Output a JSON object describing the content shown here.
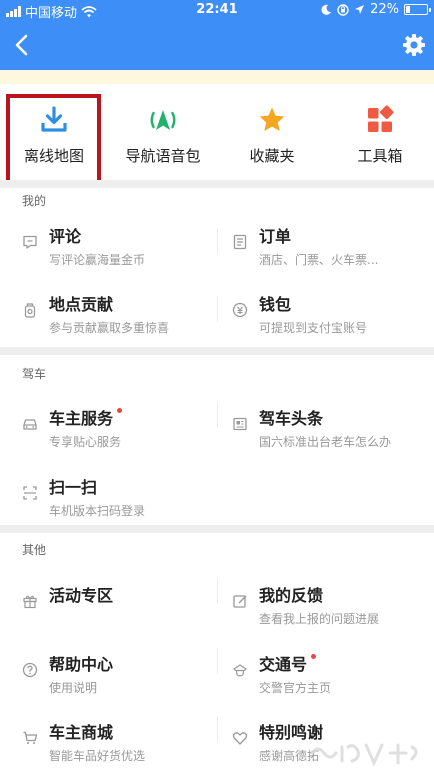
{
  "status_bar": {
    "carrier": "中国移动",
    "time": "22:41",
    "battery": "22%",
    "battery_level": 0.22
  },
  "quick_entries": [
    {
      "label": "离线地图",
      "icon": "download-icon",
      "color": "#2e8fe0"
    },
    {
      "label": "导航语音包",
      "icon": "navigation-voice-icon",
      "color": "#21b26f"
    },
    {
      "label": "收藏夹",
      "icon": "star-icon",
      "color": "#f5a623"
    },
    {
      "label": "工具箱",
      "icon": "toolbox-icon",
      "color": "#ef5a42"
    }
  ],
  "sections": [
    {
      "title": "我的",
      "items": [
        {
          "title": "评论",
          "subtitle": "写评论赢海量金币",
          "icon": "comment-icon",
          "dot": false
        },
        {
          "title": "订单",
          "subtitle": "酒店、门票、火车票...",
          "icon": "order-icon",
          "dot": false
        },
        {
          "title": "地点贡献",
          "subtitle": "参与贡献赢取多重惊喜",
          "icon": "location-contribute-icon",
          "dot": false
        },
        {
          "title": "钱包",
          "subtitle": "可提现到支付宝账号",
          "icon": "wallet-icon",
          "dot": false
        }
      ]
    },
    {
      "title": "驾车",
      "items": [
        {
          "title": "车主服务",
          "subtitle": "专享贴心服务",
          "icon": "car-icon",
          "dot": true
        },
        {
          "title": "驾车头条",
          "subtitle": "国六标准出台老车怎么办",
          "icon": "news-icon",
          "dot": false
        },
        {
          "title": "扫一扫",
          "subtitle": "车机版本扫码登录",
          "icon": "scan-icon",
          "dot": false
        }
      ]
    },
    {
      "title": "其他",
      "items": [
        {
          "title": "活动专区",
          "subtitle": "",
          "icon": "gift-icon",
          "dot": false
        },
        {
          "title": "我的反馈",
          "subtitle": "查看我上报的问题进展",
          "icon": "feedback-icon",
          "dot": false
        },
        {
          "title": "帮助中心",
          "subtitle": "使用说明",
          "icon": "help-icon",
          "dot": false
        },
        {
          "title": "交通号",
          "subtitle": "交警官方主页",
          "icon": "police-icon",
          "dot": true
        },
        {
          "title": "车主商城",
          "subtitle": "智能车品好货优选",
          "icon": "cart-icon",
          "dot": false
        },
        {
          "title": "特别鸣谢",
          "subtitle": "感谢高德拓",
          "icon": "heart-icon",
          "dot": false
        }
      ]
    }
  ],
  "accent_color": "#3d8ef6",
  "dot_color": "#f04444"
}
